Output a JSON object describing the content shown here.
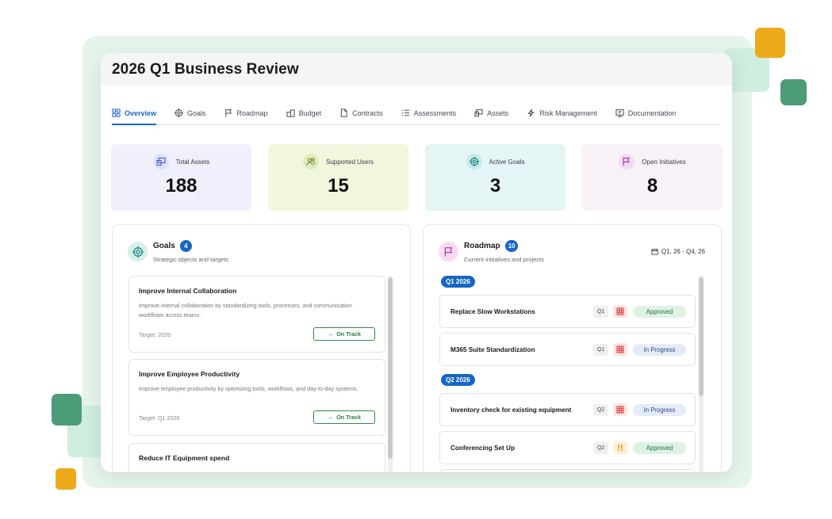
{
  "window": {
    "title": "2026 Q1 Business Review"
  },
  "tabs": [
    {
      "label": "Overview",
      "icon": "layout-icon",
      "active": true
    },
    {
      "label": "Goals",
      "icon": "target-icon",
      "active": false
    },
    {
      "label": "Roadmap",
      "icon": "flag-icon",
      "active": false
    },
    {
      "label": "Budget",
      "icon": "coins-icon",
      "active": false
    },
    {
      "label": "Contracts",
      "icon": "document-icon",
      "active": false
    },
    {
      "label": "Assessments",
      "icon": "checklist-icon",
      "active": false
    },
    {
      "label": "Assets",
      "icon": "devices-icon",
      "active": false
    },
    {
      "label": "Risk Management",
      "icon": "bolt-icon",
      "active": false
    },
    {
      "label": "Documentation",
      "icon": "monitor-doc-icon",
      "active": false
    }
  ],
  "stats": [
    {
      "label": "Total Assets",
      "value": "188",
      "icon": "devices-icon",
      "bg": "#eff0fb",
      "icon_bg": "#dfe2f6",
      "icon_color": "#4a5bc4"
    },
    {
      "label": "Supported Users",
      "value": "15",
      "icon": "users-icon",
      "bg": "#f1f7dd",
      "icon_bg": "#e1ecbd",
      "icon_color": "#6b7d22"
    },
    {
      "label": "Active Goals",
      "value": "3",
      "icon": "target-icon",
      "bg": "#e4f5f5",
      "icon_bg": "#c8ebe9",
      "icon_color": "#1e8a86"
    },
    {
      "label": "Open Initiatives",
      "value": "8",
      "icon": "flag-icon",
      "bg": "#f8f1f8",
      "icon_bg": "#f2dcef",
      "icon_color": "#b23ea6"
    }
  ],
  "goals_panel": {
    "title": "Goals",
    "count": "4",
    "subtitle": "Strategic objects and targets",
    "icon": "target-icon",
    "items": [
      {
        "title": "Improve Internal Collaboration",
        "description": "Improve internal collaboration by standardizing tools, processes, and communication workflows across teams.",
        "target": "Target: 2026",
        "status": "On Track"
      },
      {
        "title": "Improve Employee Productivity",
        "description": "Improve employee productivity by optimizing tools, workflows, and day-to-day systems.",
        "target": "Target: Q1 2026",
        "status": "On Track"
      },
      {
        "title": "Reduce IT Equipment spend",
        "description": "",
        "target": "",
        "status": ""
      }
    ]
  },
  "roadmap_panel": {
    "title": "Roadmap",
    "count": "10",
    "subtitle": "Current initiatives and projects",
    "icon": "flag-icon",
    "date_range": "Q1, 26 - Q4, 26",
    "groups": [
      {
        "label": "Q1 2026",
        "items": [
          {
            "name": "Replace Slow Workstations",
            "quarter": "Q1",
            "priority": "high",
            "status": "Approved"
          },
          {
            "name": "M365 Suite Standardization",
            "quarter": "Q1",
            "priority": "high",
            "status": "In Progress"
          }
        ]
      },
      {
        "label": "Q2 2026",
        "items": [
          {
            "name": "Inventory check for existing equipment",
            "quarter": "Q2",
            "priority": "high",
            "status": "In Progress"
          },
          {
            "name": "Conferencing Set Up",
            "quarter": "Q2",
            "priority": "medium",
            "status": "Approved"
          }
        ]
      }
    ]
  }
}
